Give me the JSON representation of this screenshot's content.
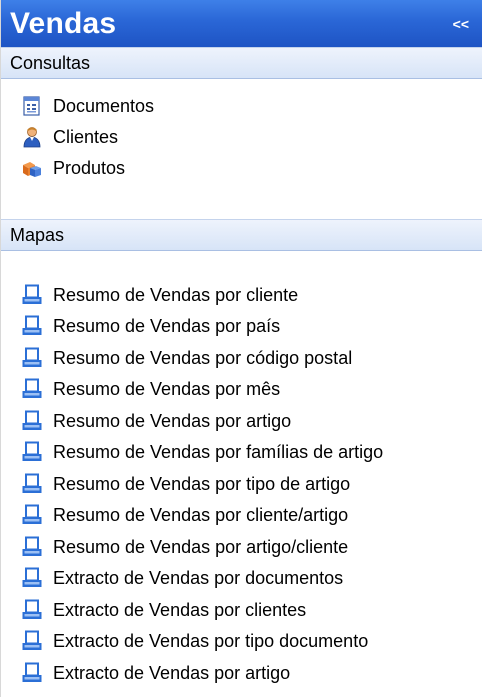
{
  "panel": {
    "title": "Vendas",
    "collapse_label": "<<"
  },
  "consultas": {
    "header": "Consultas",
    "items": [
      {
        "label": "Documentos",
        "icon": "document-icon"
      },
      {
        "label": "Clientes",
        "icon": "client-icon"
      },
      {
        "label": "Produtos",
        "icon": "products-icon"
      }
    ]
  },
  "mapas": {
    "header": "Mapas",
    "items": [
      {
        "label": "Resumo de Vendas por cliente",
        "icon": "printer-icon"
      },
      {
        "label": "Resumo de Vendas por país",
        "icon": "printer-icon"
      },
      {
        "label": "Resumo de Vendas por código postal",
        "icon": "printer-icon"
      },
      {
        "label": "Resumo de Vendas por mês",
        "icon": "printer-icon"
      },
      {
        "label": "Resumo de Vendas por artigo",
        "icon": "printer-icon"
      },
      {
        "label": "Resumo de Vendas por famílias de artigo",
        "icon": "printer-icon"
      },
      {
        "label": "Resumo de Vendas por tipo de artigo",
        "icon": "printer-icon"
      },
      {
        "label": "Resumo de Vendas por cliente/artigo",
        "icon": "printer-icon"
      },
      {
        "label": "Resumo de Vendas por artigo/cliente",
        "icon": "printer-icon"
      },
      {
        "label": "Extracto de Vendas por documentos",
        "icon": "printer-icon"
      },
      {
        "label": "Extracto de Vendas por clientes",
        "icon": "printer-icon"
      },
      {
        "label": "Extracto de Vendas por tipo documento",
        "icon": "printer-icon"
      },
      {
        "label": "Extracto de Vendas por artigo",
        "icon": "printer-icon"
      }
    ]
  },
  "colors": {
    "header_bg": "#2a66d6",
    "section_bg": "#d7e4f7",
    "printer_blue": "#2b6fd6"
  }
}
